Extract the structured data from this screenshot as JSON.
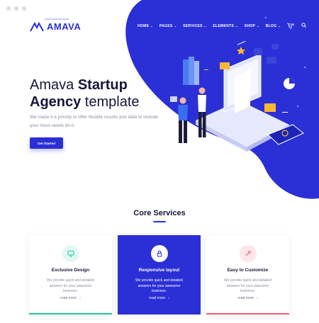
{
  "brand": {
    "name": "AMAVA"
  },
  "nav": {
    "items": [
      {
        "label": "HOME"
      },
      {
        "label": "PAGES"
      },
      {
        "label": "SERVICES"
      },
      {
        "label": "ELEMENTS"
      },
      {
        "label": "SHOP"
      },
      {
        "label": "BLOG"
      }
    ],
    "cart_count": "0"
  },
  "hero": {
    "title_plain_1": "Amava ",
    "title_bold_1": "Startup",
    "title_bold_2": "Agency",
    "title_plain_2": " template",
    "description": "We make it a priority to offer flexible results and data to include your must needs do it.",
    "cta_label": "Get Started"
  },
  "services": {
    "title": "Core Services",
    "cards": [
      {
        "title": "Exclusive Design",
        "text": "We provide quick and detailed answers for your awesome business.",
        "link": "read more",
        "icon": "monitor-icon",
        "accent": "#1fc9a1",
        "icon_bg": "#e3f8f2"
      },
      {
        "title": "Responsive layout",
        "text": "We provide quick and detailed answers for your awesome business.",
        "link": "read more",
        "icon": "lock-icon",
        "accent": "#ffffff",
        "icon_bg": "#ffffff"
      },
      {
        "title": "Easy to Customize",
        "text": "We provide quick and detailed answers for your awesome business.",
        "link": "read more",
        "icon": "wrench-icon",
        "accent": "#f25c74",
        "icon_bg": "#fde7ea"
      }
    ]
  },
  "colors": {
    "primary": "#2b2fd6",
    "heading": "#14163a",
    "muted": "#8a8da3"
  }
}
